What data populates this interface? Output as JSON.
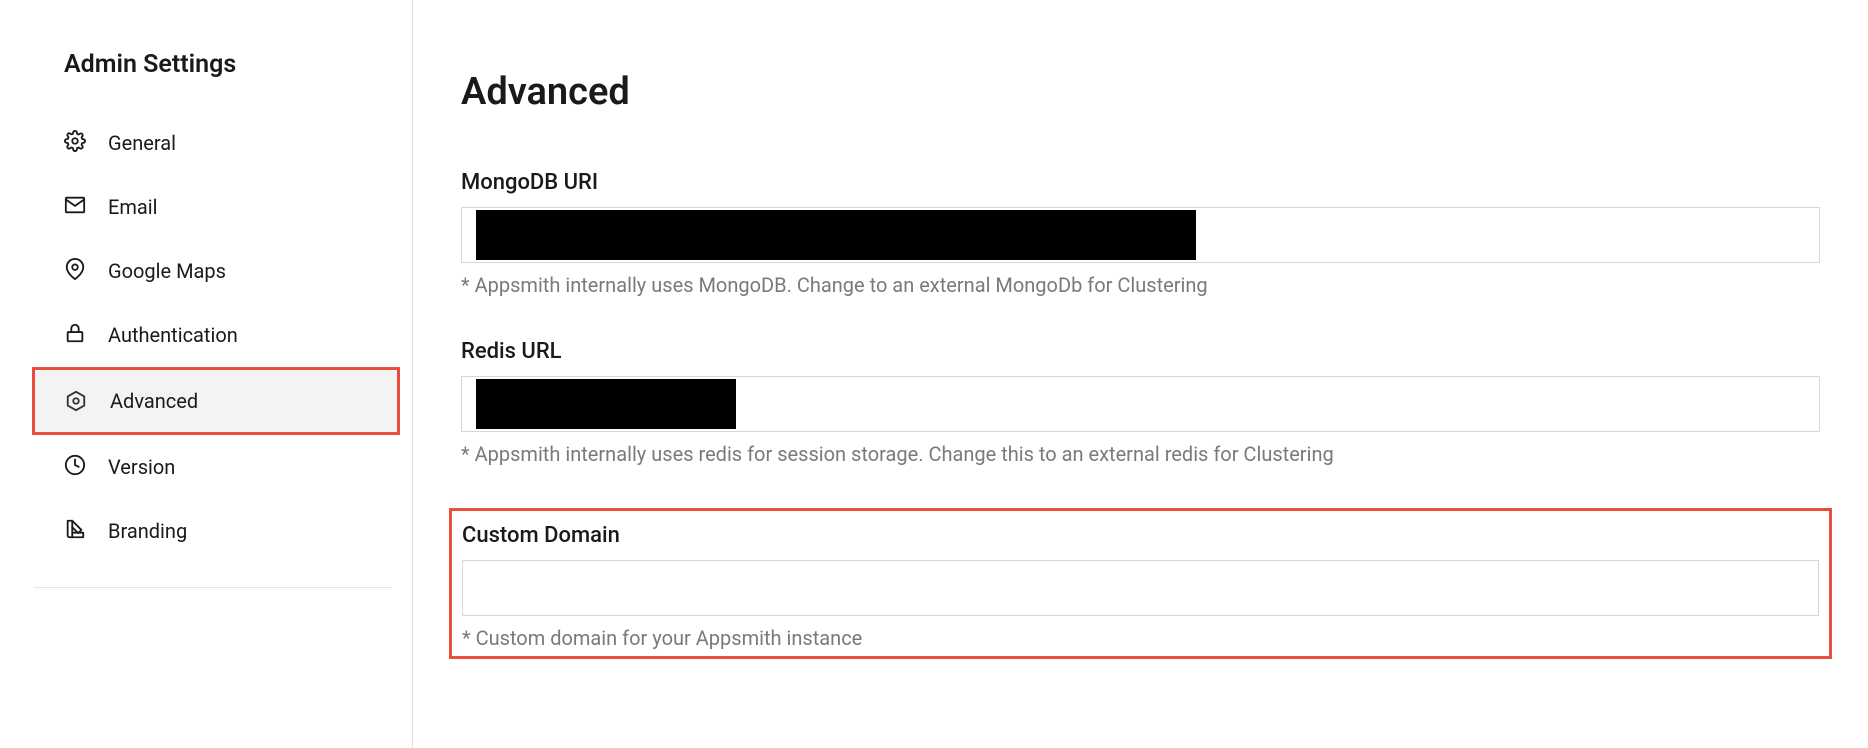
{
  "sidebar": {
    "title": "Admin Settings",
    "items": [
      {
        "label": "General"
      },
      {
        "label": "Email"
      },
      {
        "label": "Google Maps"
      },
      {
        "label": "Authentication"
      },
      {
        "label": "Advanced"
      },
      {
        "label": "Version"
      },
      {
        "label": "Branding"
      }
    ],
    "selected_index": 4
  },
  "main": {
    "title": "Advanced",
    "fields": {
      "mongodb": {
        "label": "MongoDB URI",
        "value_redacted": true,
        "hint": "* Appsmith internally uses MongoDB. Change to an external MongoDb for Clustering"
      },
      "redis": {
        "label": "Redis URL",
        "value_redacted": true,
        "hint": "* Appsmith internally uses redis for session storage. Change this to an external redis for Clustering"
      },
      "custom_domain": {
        "label": "Custom Domain",
        "value": "",
        "hint": "* Custom domain for your Appsmith instance"
      }
    }
  }
}
